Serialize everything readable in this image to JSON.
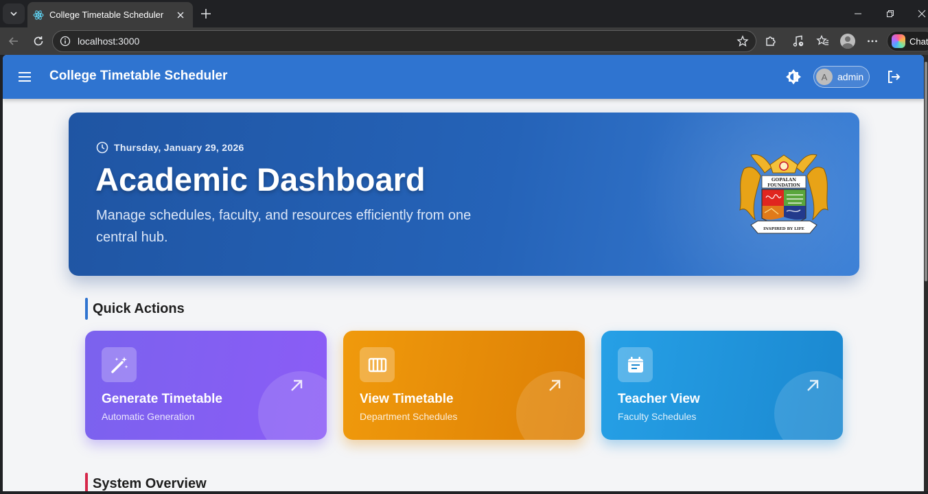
{
  "browser": {
    "tab_title": "College Timetable Scheduler",
    "url": "localhost:3000",
    "copilot_label": "Chat"
  },
  "app": {
    "title": "College Timetable Scheduler",
    "user_initial": "A",
    "user_name": "admin",
    "accent_color": "#2f74d0"
  },
  "hero": {
    "date": "Thursday, January 29, 2026",
    "title": "Academic Dashboard",
    "subtitle": "Manage schedules, faculty, and resources efficiently from one central hub.",
    "emblem": {
      "top_text": "GOPALAN",
      "middle_text": "FOUNDATION",
      "ribbon_text": "INSPIRED BY LIFE"
    }
  },
  "sections": {
    "quick_actions": "Quick Actions",
    "system_overview": "System Overview"
  },
  "quick_actions": [
    {
      "title": "Generate Timetable",
      "subtitle": "Automatic Generation",
      "icon": "magic-wand-icon",
      "color": "#7b62ee"
    },
    {
      "title": "View Timetable",
      "subtitle": "Department Schedules",
      "icon": "view-columns-icon",
      "color": "#f09a0c"
    },
    {
      "title": "Teacher View",
      "subtitle": "Faculty Schedules",
      "icon": "event-note-icon",
      "color": "#26a0e6"
    }
  ]
}
